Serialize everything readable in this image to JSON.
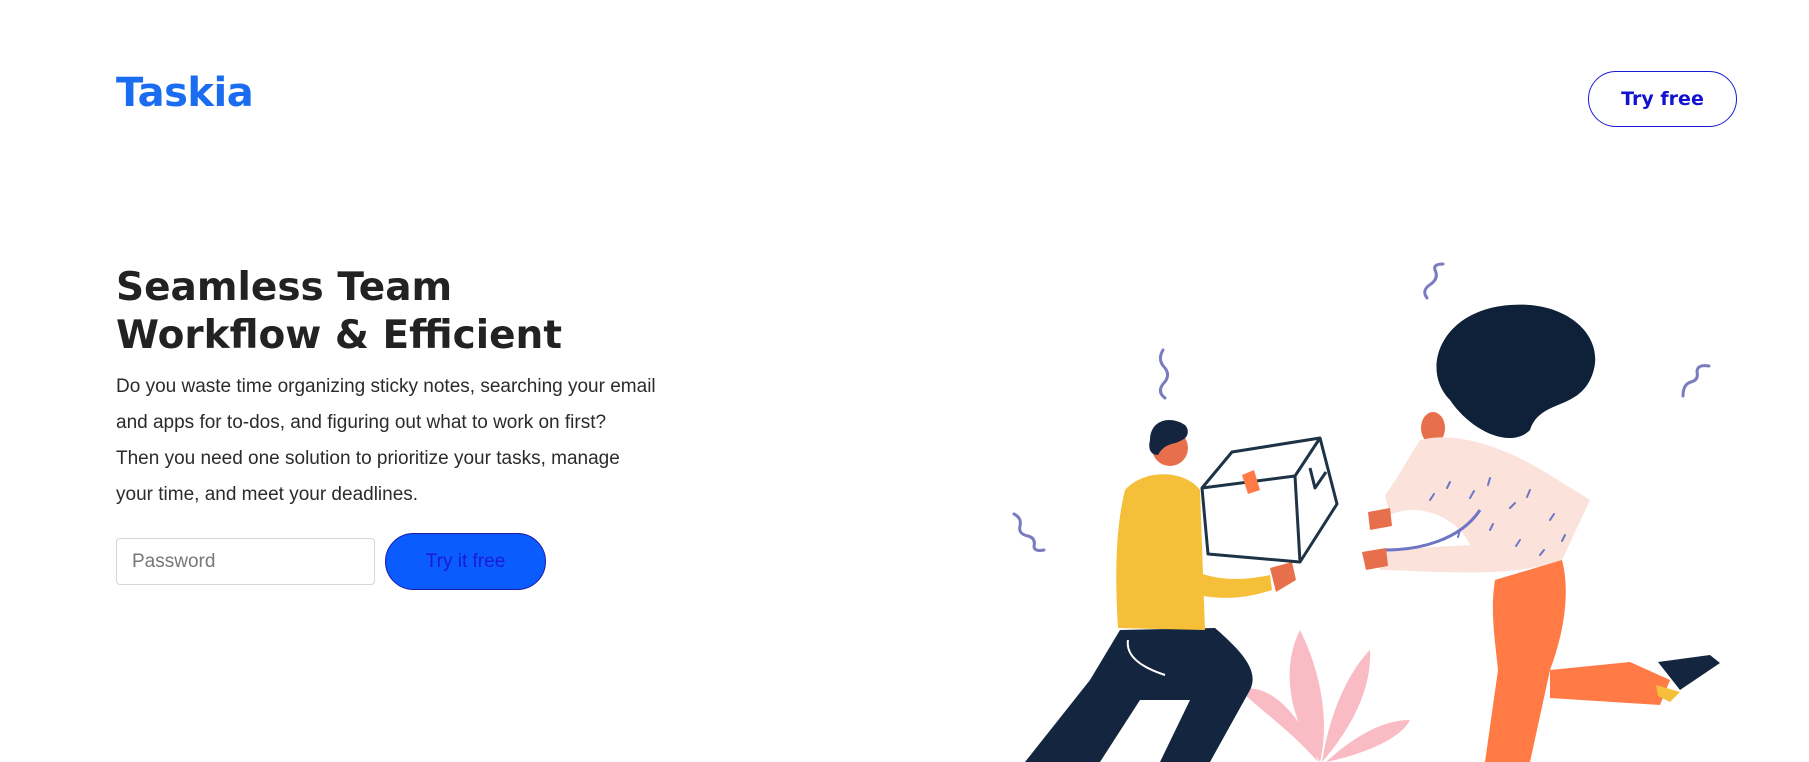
{
  "header": {
    "logo": "Taskia",
    "cta_label": "Try free"
  },
  "hero": {
    "title_lines": [
      "Seamless Team",
      "Workflow & Efficient"
    ],
    "description_lines": [
      "Do you waste time organizing sticky notes, searching your email",
      "and apps for to-dos, and figuring out what to work on first?",
      "Then you need one solution to prioritize your tasks, manage",
      "your time, and meet your deadlines."
    ],
    "input_placeholder": "Password",
    "input_value": "",
    "cta_label": "Try it free"
  },
  "illustration": {
    "icon": "people-exchanging-box-illustration",
    "colors": {
      "skin": "#e86f4c",
      "yellow": "#f5bf3a",
      "navy": "#14253f",
      "orange": "#ff7a45",
      "pink_plant": "#f9bcc4",
      "squiggle": "#7b7bbf",
      "shirt": "#fbe3dc"
    }
  },
  "colors": {
    "brand": "#1a6cf0",
    "cta_fill": "#0b5cff",
    "cta_border": "#1a1ad6",
    "text_dark": "#222222"
  }
}
